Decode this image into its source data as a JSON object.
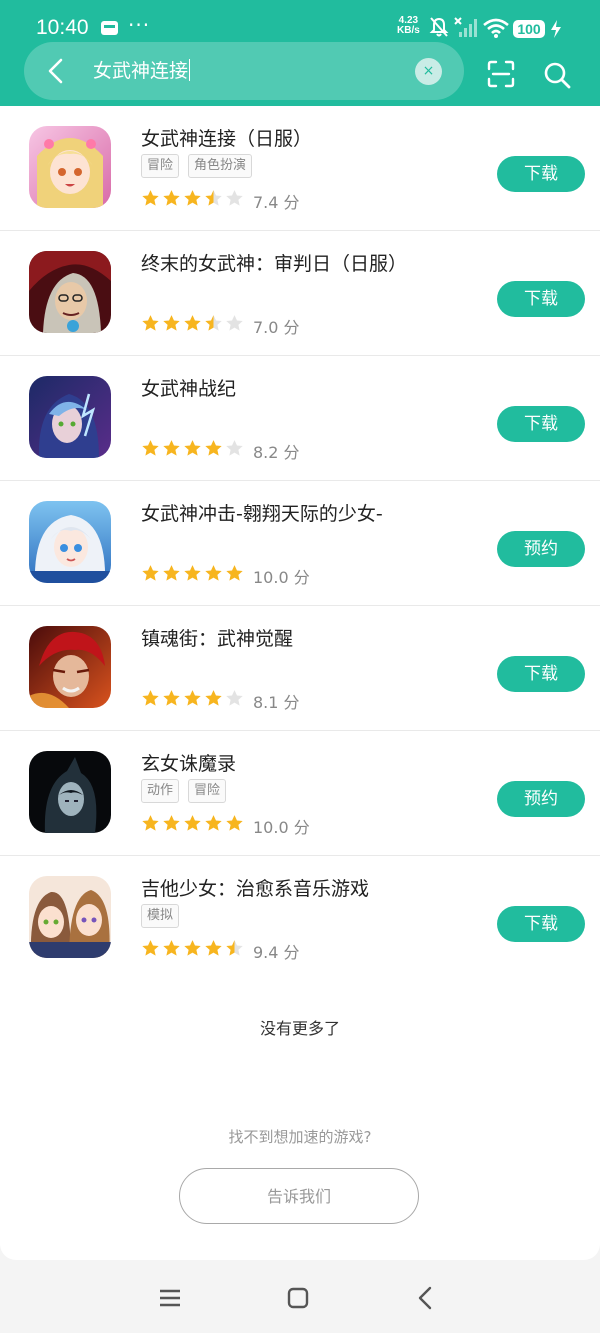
{
  "status_bar": {
    "time": "10:40",
    "net_speed_value": "4.23",
    "net_speed_unit": "KB/s",
    "battery": "100"
  },
  "search": {
    "query": "女武神连接",
    "clear_symbol": "×"
  },
  "colors": {
    "brand": "#21bc9e",
    "star": "#f7b51f",
    "star_empty": "#e3e3e3"
  },
  "results": [
    {
      "title": "女武神连接（日服）",
      "tags": [
        "冒险",
        "角色扮演"
      ],
      "rating": 3.5,
      "score": "7.4 分",
      "action": "下载"
    },
    {
      "title": "终末的女武神：审判日（日服）",
      "tags": [],
      "rating": 3.5,
      "score": "7.0 分",
      "action": "下载"
    },
    {
      "title": "女武神战纪",
      "tags": [],
      "rating": 4,
      "score": "8.2 分",
      "action": "下载"
    },
    {
      "title": "女武神冲击-翱翔天际的少女-",
      "tags": [],
      "rating": 5,
      "score": "10.0 分",
      "action": "预约"
    },
    {
      "title": "镇魂街：武神觉醒",
      "tags": [],
      "rating": 4,
      "score": "8.1 分",
      "action": "下载"
    },
    {
      "title": "玄女诛魔录",
      "tags": [
        "动作",
        "冒险"
      ],
      "rating": 5,
      "score": "10.0 分",
      "action": "预约"
    },
    {
      "title": "吉他少女：治愈系音乐游戏",
      "tags": [
        "模拟"
      ],
      "rating": 4.5,
      "score": "9.4 分",
      "action": "下载"
    }
  ],
  "footer": {
    "no_more": "没有更多了",
    "not_found": "找不到想加速的游戏?",
    "tell_us": "告诉我们"
  }
}
